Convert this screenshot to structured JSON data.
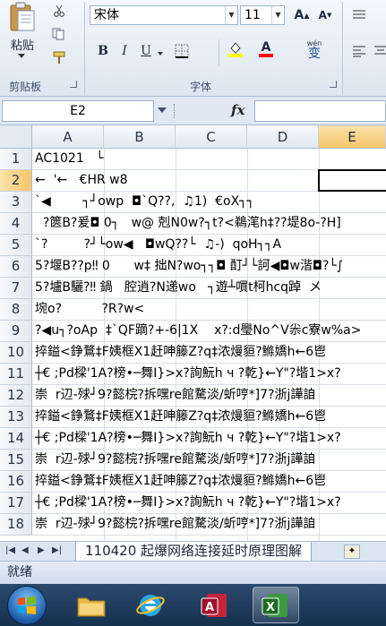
{
  "ribbon": {
    "clipboard_group_label": "剪贴板",
    "font_group_label": "字体",
    "paste_label": "粘贴",
    "font_name": "宋体",
    "font_size": "11",
    "bold_label": "B",
    "italic_label": "I",
    "underline_label": "U",
    "font_color_letter": "A",
    "phonetic_label": "wén",
    "phonetic_char": "变"
  },
  "formula_bar": {
    "name_box": "E2",
    "fx_label": "fx",
    "formula": ""
  },
  "columns": [
    "A",
    "B",
    "C",
    "D",
    "E"
  ],
  "selected_column": "E",
  "rows": [
    {
      "num": "1",
      "text": "AC1021   └"
    },
    {
      "num": "2",
      "text": "←  '←   €HR w8"
    },
    {
      "num": "3",
      "text": "`◀        ┐┘owp  ◘`Q??,  ♫1)  €oX┐┐"
    },
    {
      "num": "4",
      "text": "  ?篋B?爰◘ 0┐   w@ 剋N0w?┐t?<鵜滗h‡??堤8o-?H]"
    },
    {
      "num": "5",
      "text": "`?         ?┘└ow◀   ◘wQ??└  ♫-)  qoH┐┐A"
    },
    {
      "num": "6",
      "text": "5?堰B??p‼ 0      w‡ 拙N?wo┐┐◘ 酊┘└訶◀◘w湝◘?└∫"
    },
    {
      "num": "7",
      "text": "5?壚B驪?‼ 鍋   腔逍?N递wo   ┐遊┴嘪t柯hcq踔  メ"
    },
    {
      "num": "8",
      "text": "埦o?          ?R?w<"
    },
    {
      "num": "9",
      "text": "?◀u┐?oAp  ‡`QF蹢?+-6|1X    x?:d璺No^V尜c寮w%a>"
    },
    {
      "num": "10",
      "text": "捽鎰<錚鶩‡F姨框X1赶呻籐Z?q‡浓熳貆?鰷嬌h←6鬯"
    },
    {
      "num": "11",
      "text": "┼€ ;Pd樑'1A?榜•─舞I}>x?詢魭h ч ?乾}←Y\"?堦1>x?"
    },
    {
      "num": "12",
      "text": "崇  r辺-殏┘9?懿梡?拆嘿re館騖淡/蚚哼*]7?浙j譁詯"
    },
    {
      "num": "13",
      "text": "捽鎰<錚鶩‡F姨框X1赶呻籐Z?q‡浓熳貆?鰷嬌h←6鬯"
    },
    {
      "num": "14",
      "text": "┼€ ;Pd樑'1A?榜•─舞I}>x?詢魭h ч ?乾}←Y\"?堦1>x?"
    },
    {
      "num": "15",
      "text": "崇  r辺-殏┘9?懿梡?拆嘿re館騖淡/蚚哼*]7?浙j譁詯"
    },
    {
      "num": "16",
      "text": "捽鎰<錚鶩‡F姨框X1赶呻籐Z?q‡浓熳貆?鰷嬌h←6鬯"
    },
    {
      "num": "17",
      "text": "┼€ ;Pd樑'1A?榜•─舞I}>x?詢魭h ч ?乾}←Y\"?堦1>x?"
    },
    {
      "num": "18",
      "text": "崇  r辺-殏┘9?懿梡?拆嘿re館騖淡/蚚哼*]7?浙j譁詯"
    }
  ],
  "sheet_tab": "110420 起爆网络连接延时原理图解",
  "status": "就绪",
  "taskbar": {
    "items": [
      "start",
      "explorer",
      "ie",
      "access",
      "excel"
    ]
  },
  "colors": {
    "selection_header": "#f5c66b",
    "ribbon_bg": "#dde6f1",
    "taskbar_bg": "#16304f"
  }
}
